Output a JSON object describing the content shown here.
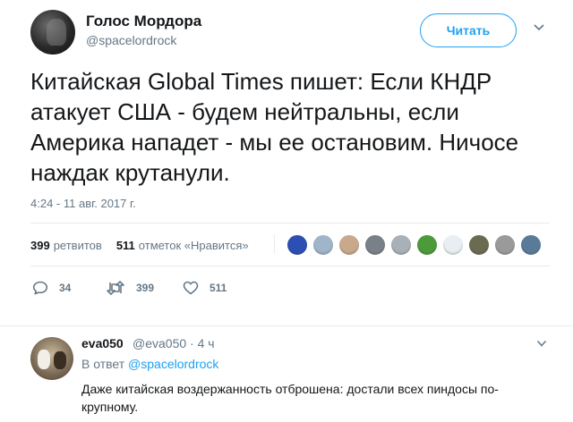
{
  "tweet": {
    "display_name": "Голос Мордора",
    "screen_name": "@spacelordrock",
    "follow_label": "Читать",
    "text": "Китайская Global Times пишет: Если КНДР атакует США - будем нейтральны, если Америка нападет - мы ее остановим. Ничосе наждак крутанули.",
    "timestamp": "4:24 - 11 авг. 2017 г.",
    "retweets_count": "399",
    "retweets_label": "ретвитов",
    "likes_count": "511",
    "likes_label": "отметок «Нравится»",
    "actions": {
      "reply_count": "34",
      "retweet_count": "399",
      "like_count": "511"
    },
    "liker_avatar_colors": [
      "#2b4fb3",
      "#9fb5c9",
      "#c8a98c",
      "#7a8088",
      "#a8b0b8",
      "#4d9a3a",
      "#e8eef2",
      "#6b6b52",
      "#9a9a9a",
      "#5a7a9a"
    ]
  },
  "reply": {
    "display_name": "eva050",
    "meta": "@eva050 · 4 ч",
    "in_reply_prefix": "В ответ",
    "in_reply_mention": "@spacelordrock",
    "text": "Даже китайская воздержанность отброшена: достали всех пиндосы по-крупному."
  },
  "colors": {
    "accent": "#1da1f2",
    "muted": "#657786",
    "text": "#14171a",
    "like_heart": "#657786"
  }
}
